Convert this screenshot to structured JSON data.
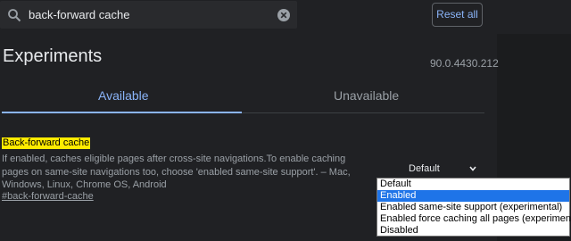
{
  "search": {
    "value": "back-forward cache",
    "reset_label": "Reset all"
  },
  "header": {
    "title": "Experiments",
    "version": "90.0.4430.212"
  },
  "tabs": [
    {
      "label": "Available",
      "active": true
    },
    {
      "label": "Unavailable",
      "active": false
    }
  ],
  "experiment": {
    "name": "Back-forward cache",
    "description": "If enabled, caches eligible pages after cross-site navigations.To enable caching pages on same-site navigations too, choose 'enabled same-site support'. – Mac, Windows, Linux, Chrome OS, Android",
    "link": "#back-forward-cache",
    "selected_value": "Default",
    "options": [
      "Default",
      "Enabled",
      "Enabled same-site support (experimental)",
      "Enabled force caching all pages (experimental)",
      "Disabled"
    ],
    "highlighted_option": "Enabled"
  },
  "colors": {
    "background": "#202124",
    "accent": "#8ab4f8",
    "highlight": "#ffeb00",
    "option_selected": "#1e74e8"
  }
}
